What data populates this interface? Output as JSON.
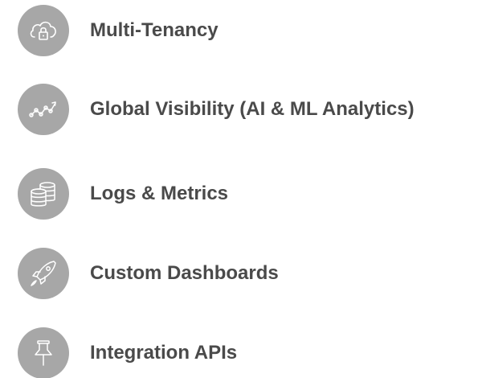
{
  "features": [
    {
      "label": "Multi-Tenancy",
      "icon": "cloud-lock-icon"
    },
    {
      "label": "Global Visibility (AI & ML Analytics)",
      "icon": "trend-chart-icon"
    },
    {
      "label": "Logs & Metrics",
      "icon": "database-icon"
    },
    {
      "label": "Custom Dashboards",
      "icon": "rocket-icon"
    },
    {
      "label": "Integration APIs",
      "icon": "pushpin-icon"
    }
  ],
  "colors": {
    "circle": "#a7a7a7",
    "text": "#4a4a4a",
    "icon_stroke": "#ffffff"
  }
}
